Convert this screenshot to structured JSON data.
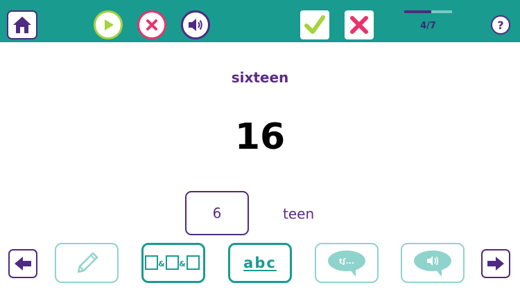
{
  "header": {
    "progress": {
      "current": 4,
      "total": 7,
      "label": "4/7",
      "fraction": 0.571
    },
    "icons": {
      "home": "home-icon",
      "play": "play-icon",
      "stop": "close-icon",
      "sound": "speaker-icon",
      "check": "checkmark-icon",
      "wrong": "cross-icon",
      "help": "question-icon"
    }
  },
  "main": {
    "word": "sixteen",
    "number": "16",
    "digit_box": "6",
    "suffix": "teen"
  },
  "toolbar": {
    "pattern_label": "□&□&□",
    "abc_label": "abc",
    "phonetic_label": "tʃ..."
  },
  "colors": {
    "teal": "#199b90",
    "purple": "#4e2a82",
    "green": "#a6d23d",
    "pink": "#e8336b"
  }
}
